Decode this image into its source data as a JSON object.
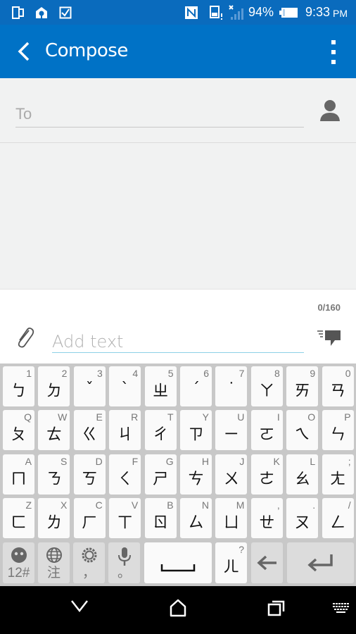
{
  "status_bar": {
    "left_icons": [
      "dual-screen-icon",
      "location-pin-icon",
      "checkbox-icon"
    ],
    "right_icons": [
      "nfc-icon",
      "sim-alert-icon",
      "signal-no-service-icon"
    ],
    "battery_percent": "94%",
    "battery_icon": "battery-icon",
    "time": "9:33",
    "ampm": "PM"
  },
  "app_bar": {
    "title": "Compose",
    "back_icon": "back-arrow-icon",
    "menu_icon": "overflow-menu-icon"
  },
  "recipient": {
    "placeholder": "To",
    "value": "",
    "contact_icon": "person-icon"
  },
  "message": {
    "counter": "0/160",
    "placeholder": "Add text",
    "value": "",
    "attach_icon": "paperclip-icon",
    "send_icon": "send-message-icon"
  },
  "keyboard": {
    "rows": [
      [
        {
          "main": "ㄅ",
          "hint": "1"
        },
        {
          "main": "ㄉ",
          "hint": "2"
        },
        {
          "main": "ˇ",
          "hint": "3"
        },
        {
          "main": "ˋ",
          "hint": "4"
        },
        {
          "main": "ㄓ",
          "hint": "5"
        },
        {
          "main": "ˊ",
          "hint": "6"
        },
        {
          "main": "˙",
          "hint": "7"
        },
        {
          "main": "ㄚ",
          "hint": "8"
        },
        {
          "main": "ㄞ",
          "hint": "9"
        },
        {
          "main": "ㄢ",
          "hint": "0"
        }
      ],
      [
        {
          "main": "ㄆ",
          "hint": "Q"
        },
        {
          "main": "ㄊ",
          "hint": "W"
        },
        {
          "main": "ㄍ",
          "hint": "E"
        },
        {
          "main": "ㄐ",
          "hint": "R"
        },
        {
          "main": "ㄔ",
          "hint": "T"
        },
        {
          "main": "ㄗ",
          "hint": "Y"
        },
        {
          "main": "ㄧ",
          "hint": "U"
        },
        {
          "main": "ㄛ",
          "hint": "I"
        },
        {
          "main": "ㄟ",
          "hint": "O"
        },
        {
          "main": "ㄣ",
          "hint": "P"
        }
      ],
      [
        {
          "main": "ㄇ",
          "hint": "A"
        },
        {
          "main": "ㄋ",
          "hint": "S"
        },
        {
          "main": "ㄎ",
          "hint": "D"
        },
        {
          "main": "ㄑ",
          "hint": "F"
        },
        {
          "main": "ㄕ",
          "hint": "G"
        },
        {
          "main": "ㄘ",
          "hint": "H"
        },
        {
          "main": "ㄨ",
          "hint": "J"
        },
        {
          "main": "ㄜ",
          "hint": "K"
        },
        {
          "main": "ㄠ",
          "hint": "L"
        },
        {
          "main": "ㄤ",
          "hint": ";"
        }
      ],
      [
        {
          "main": "ㄈ",
          "hint": "Z"
        },
        {
          "main": "ㄌ",
          "hint": "X"
        },
        {
          "main": "ㄏ",
          "hint": "C"
        },
        {
          "main": "ㄒ",
          "hint": "V"
        },
        {
          "main": "ㄖ",
          "hint": "B"
        },
        {
          "main": "ㄙ",
          "hint": "N"
        },
        {
          "main": "ㄩ",
          "hint": "M"
        },
        {
          "main": "ㄝ",
          "hint": ","
        },
        {
          "main": "ㄡ",
          "hint": "."
        },
        {
          "main": "ㄥ",
          "hint": "/"
        }
      ]
    ],
    "bottom_row": {
      "symbols_label": "12#",
      "symbols_icon": "emoji-icon",
      "language_label": "注",
      "language_icon": "globe-icon",
      "settings_label": "，",
      "settings_icon": "gear-icon",
      "voice_label": "。",
      "voice_icon": "microphone-icon",
      "space_icon": "space-bar-icon",
      "er_main": "ㄦ",
      "er_hint": "?",
      "backspace_icon": "backspace-arrow-icon",
      "enter_icon": "enter-icon"
    }
  },
  "nav_bar": {
    "items": [
      "hide-keyboard-chevron-icon",
      "home-icon",
      "recents-icon",
      "keyboard-switch-icon"
    ]
  }
}
